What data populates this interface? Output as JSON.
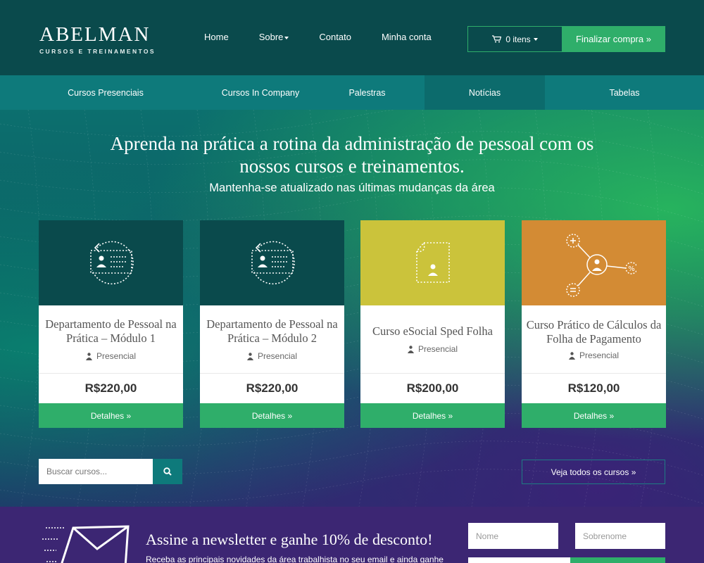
{
  "header": {
    "logo_name": "ABELMAN",
    "logo_sub": "CURSOS E TREINAMENTOS",
    "nav": [
      "Home",
      "Sobre",
      "Contato",
      "Minha conta"
    ],
    "cart_label": "0 itens",
    "checkout_label": "Finalizar compra »"
  },
  "subnav": [
    "Cursos Presenciais",
    "Cursos In Company",
    "Palestras",
    "Notícias",
    "Tabelas"
  ],
  "hero": {
    "title": "Aprenda na prática a rotina da administração de pessoal com os nossos cursos e treinamentos.",
    "subtitle": "Mantenha-se atualizado nas últimas mudanças da área"
  },
  "cards": [
    {
      "title": "Departamento de Pessoal na Prática – Módulo 1",
      "mode": "Presencial",
      "price": "R$220,00",
      "button": "Detalhes »",
      "color": "#0a4a4c",
      "icon": "id-card-icon"
    },
    {
      "title": "Departamento de Pessoal na Prática – Módulo 2",
      "mode": "Presencial",
      "price": "R$220,00",
      "button": "Detalhes »",
      "color": "#0a4a4c",
      "icon": "id-card-icon"
    },
    {
      "title": "Curso eSocial Sped Folha",
      "mode": "Presencial",
      "price": "R$200,00",
      "button": "Detalhes »",
      "color": "#cbc33b",
      "icon": "document-user-icon"
    },
    {
      "title": "Curso Prático de Cálculos da Folha de Pagamento",
      "mode": "Presencial",
      "price": "R$120,00",
      "button": "Detalhes »",
      "color": "#d38b34",
      "icon": "calculation-network-icon"
    }
  ],
  "search": {
    "placeholder": "Buscar cursos..."
  },
  "all_courses_label": "Veja todos os cursos »",
  "newsletter": {
    "title": "Assine a newsletter e ganhe 10% de desconto!",
    "text": "Receba as principais novidades da área trabalhista no seu email e ainda ganhe",
    "first_name_placeholder": "Nome",
    "last_name_placeholder": "Sobrenome"
  },
  "colors": {
    "primary_dark": "#0a4a4c",
    "teal": "#0e7a7b",
    "green": "#2fae6a",
    "purple": "#3c2673"
  }
}
